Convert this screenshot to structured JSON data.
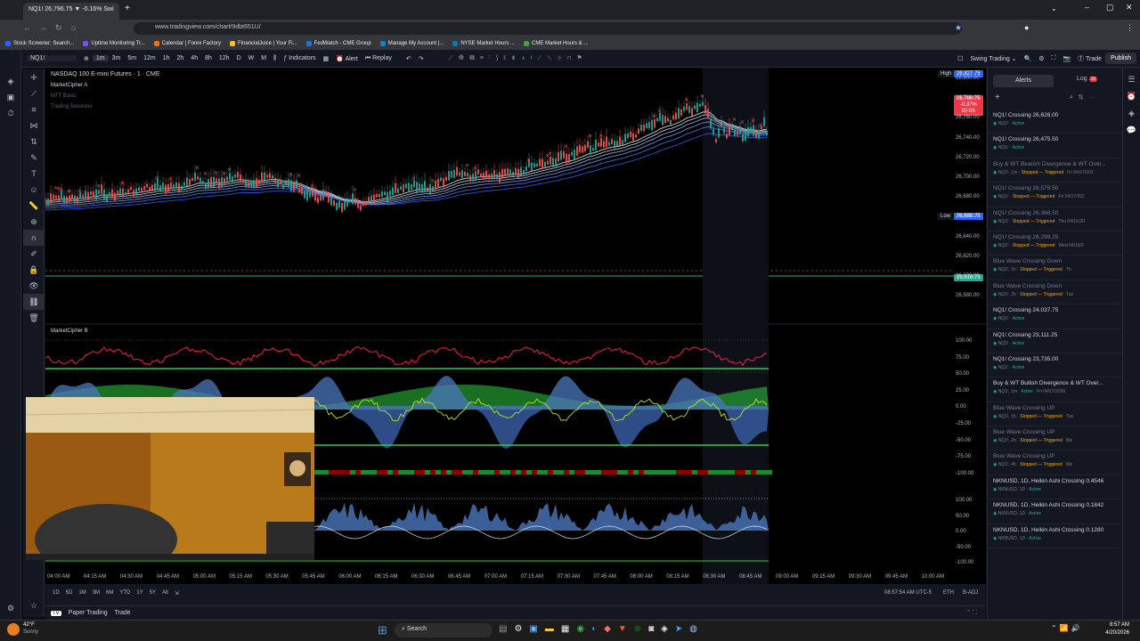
{
  "browser": {
    "tab_title": "NQ1! 26,796.75 ▼ -0.16% Swi",
    "new_tab": "+",
    "url": "www.tradingview.com/chart/9dbt651U/",
    "bookmarks": [
      "Stock Screener: Search...",
      "Uptime Monitoring Tr...",
      "Calendar | Forex Factory",
      "FinancialJuice | Your Fi...",
      "FedWatch - CME Group",
      "Manage My Account |...",
      "NYSE Market Hours ...",
      "CME Market Hours & ..."
    ]
  },
  "toolbar": {
    "symbol": "NQ1!",
    "intervals": [
      "1m",
      "3m",
      "5m",
      "12m",
      "1h",
      "2h",
      "4h",
      "8h",
      "12h",
      "D",
      "W",
      "M"
    ],
    "indicators": "Indicators",
    "alert": "Alert",
    "replay": "Replay",
    "layout": "Swing Trading",
    "trade": "Trade",
    "publish": "Publish"
  },
  "chart": {
    "title": "NASDAQ 100 E-mini Futures · 1 · CME",
    "ind1": "MarketCipher A",
    "ind1b": "MTT Basic",
    "ind1c": "Trading Sessions",
    "ind2": "MarketCipher B",
    "high_label": "High",
    "high_value": "26,827.75",
    "low_label": "Low",
    "low_value": "26,680.75",
    "last_price": "26,796.75",
    "last_change": "-0.37%",
    "last_time": "03:05",
    "green_line": "26,618.75",
    "price_ticks": [
      "26,800.00",
      "26,780.00",
      "26,760.00",
      "26,740.00",
      "26,720.00",
      "26,700.00",
      "26,680.00",
      "26,660.00",
      "26,640.00",
      "26,620.00",
      "26,600.00",
      "26,580.00"
    ],
    "osc_ticks": [
      "100.00",
      "75.00",
      "50.00",
      "25.00",
      "0.00",
      "-25.00",
      "-50.00",
      "-75.00",
      "-100.00"
    ],
    "osc2_ticks": [
      "100.00",
      "50.00",
      "0.00",
      "-50.00",
      "-100.00"
    ],
    "time_ticks": [
      "04:00 AM",
      "04:15 AM",
      "04:30 AM",
      "04:45 AM",
      "05:00 AM",
      "05:15 AM",
      "05:30 AM",
      "05:45 AM",
      "06:00 AM",
      "06:15 AM",
      "06:30 AM",
      "06:45 AM",
      "07:00 AM",
      "07:15 AM",
      "07:30 AM",
      "07:45 AM",
      "08:00 AM",
      "08:15 AM",
      "08:30 AM",
      "08:45 AM",
      "09:00 AM",
      "09:15 AM",
      "09:30 AM",
      "09:45 AM",
      "10:00 AM"
    ],
    "ranges": [
      "1D",
      "5D",
      "1M",
      "3M",
      "6M",
      "YTD",
      "1Y",
      "5Y",
      "All"
    ],
    "clock": "08:57:54 AM UTC-5",
    "eth": "ETH",
    "badj": "B-ADJ"
  },
  "alerts_panel": {
    "tab_alerts": "Alerts",
    "tab_log": "Log",
    "log_badge": "15",
    "items": [
      {
        "title": "NQ1! Crossing 26,626.00",
        "sym": "NQ1!",
        "status": "Active",
        "dim": false,
        "extra": ""
      },
      {
        "title": "NQ1! Crossing 26,475.50",
        "sym": "NQ1!",
        "status": "Active",
        "dim": false,
        "extra": ""
      },
      {
        "title": "Buy & WT Bearish Divergence & WT Over...",
        "sym": "NQ1!, 1m",
        "status": "Stopped — Triggered",
        "dim": true,
        "extra": "Fri 04/17/202"
      },
      {
        "title": "NQ1! Crossing 26,579.50",
        "sym": "NQ1!",
        "status": "Stopped — Triggered",
        "dim": true,
        "extra": "Fri 04/17/202"
      },
      {
        "title": "NQ1! Crossing 26,368.50",
        "sym": "NQ1!",
        "status": "Stopped — Triggered",
        "dim": true,
        "extra": "Thu 04/16/20"
      },
      {
        "title": "NQ1! Crossing 26,298.25",
        "sym": "NQ1!",
        "status": "Stopped — Triggered",
        "dim": true,
        "extra": "Wed 04/15/2"
      },
      {
        "title": "Blue Wave Crossing Down",
        "sym": "NQ1!, 1h",
        "status": "Stopped — Triggered",
        "dim": true,
        "extra": "Th"
      },
      {
        "title": "Blue Wave Crossing Down",
        "sym": "NQ1!, 2h",
        "status": "Stopped — Triggered",
        "dim": true,
        "extra": "Tue"
      },
      {
        "title": "NQ1! Crossing 24,037.75",
        "sym": "NQ1!",
        "status": "Active",
        "dim": false,
        "extra": ""
      },
      {
        "title": "NQ1! Crossing 23,111.25",
        "sym": "NQ1!",
        "status": "Active",
        "dim": false,
        "extra": ""
      },
      {
        "title": "NQ1! Crossing 23,735.00",
        "sym": "NQ1!",
        "status": "Active",
        "dim": false,
        "extra": ""
      },
      {
        "title": "Buy & WT Bullish Divergence & WT Over...",
        "sym": "NQ1!, 1m",
        "status": "Active",
        "dim": false,
        "extra": "Fri 04/17/2026"
      },
      {
        "title": "Blue Wave Crossing UP",
        "sym": "NQ1!, 1h",
        "status": "Stopped — Triggered",
        "dim": true,
        "extra": "Tue"
      },
      {
        "title": "Blue Wave Crossing UP",
        "sym": "NQ1!, 2h",
        "status": "Stopped — Triggered",
        "dim": true,
        "extra": "We"
      },
      {
        "title": "Blue Wave Crossing UP",
        "sym": "NQ1!, 4h",
        "status": "Stopped — Triggered",
        "dim": true,
        "extra": "We"
      },
      {
        "title": "NKNUSD, 1D, Heikin Ashi Crossing 0.4546",
        "sym": "NKNUSD, 1D",
        "status": "Active",
        "dim": false,
        "extra": ""
      },
      {
        "title": "NKNUSD, 1D, Heikin Ashi Crossing 0.1842",
        "sym": "NKNUSD, 1D",
        "status": "Active",
        "dim": false,
        "extra": ""
      },
      {
        "title": "NKNUSD, 1D, Heikin Ashi Crossing 0.1280",
        "sym": "NKNUSD, 1D",
        "status": "Active",
        "dim": false,
        "extra": ""
      }
    ]
  },
  "bottom": {
    "paper": "Paper Trading",
    "trade": "Trade"
  },
  "taskbar": {
    "temp": "42°F",
    "weather": "Sunny",
    "search": "Search",
    "time": "8:57 AM",
    "date": "4/20/2026"
  }
}
